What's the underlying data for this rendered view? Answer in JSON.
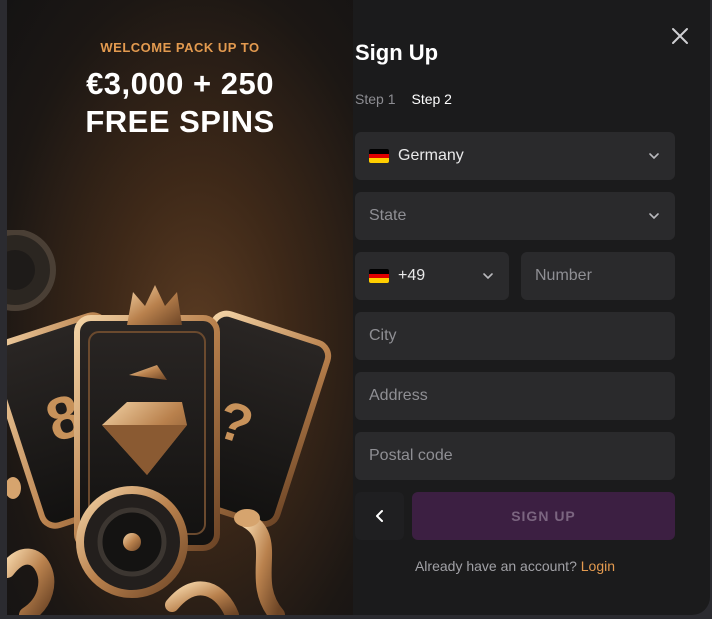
{
  "promo": {
    "kicker": "WELCOME PACK UP TO",
    "headline_line1": "€3,000 + 250",
    "headline_line2": "FREE SPINS"
  },
  "form": {
    "title": "Sign Up",
    "steps": [
      {
        "label": "Step 1",
        "active": false
      },
      {
        "label": "Step 2",
        "active": true
      }
    ],
    "country": {
      "value": "Germany",
      "flag": "flag-de"
    },
    "state": {
      "placeholder": "State"
    },
    "phone_code": {
      "value": "+49",
      "flag": "flag-de"
    },
    "phone_number": {
      "placeholder": "Number"
    },
    "city": {
      "placeholder": "City"
    },
    "address": {
      "placeholder": "Address"
    },
    "postal_code": {
      "placeholder": "Postal code"
    },
    "back_icon": "chevron-left-icon",
    "submit_label": "SIGN UP",
    "footer_text": "Already have an account?",
    "footer_link": "Login"
  },
  "close_icon": "close-icon",
  "colors": {
    "accent": "#e39a4f",
    "submit_bg": "#3c1f42",
    "field_bg": "#2a2a2c",
    "modal_bg": "#1b1b1c"
  }
}
